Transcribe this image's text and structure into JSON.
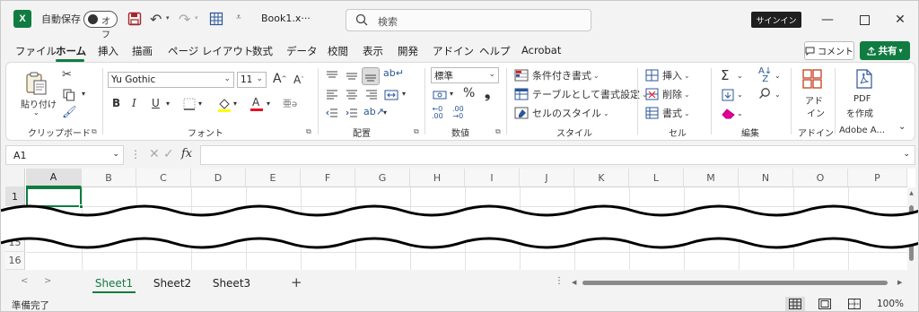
{
  "titlebar": {
    "app_icon_letter": "X",
    "autosave_label": "自動保存",
    "autosave_state": "オフ",
    "filename": "Book1.x···",
    "qat_more": "⩡",
    "search_placeholder": "検索",
    "signin_label": "サインイン"
  },
  "tabs": [
    {
      "label": "ファイル",
      "active": false
    },
    {
      "label": "ホーム",
      "active": true
    },
    {
      "label": "挿入",
      "active": false
    },
    {
      "label": "描画",
      "active": false
    },
    {
      "label": "ページ レイアウト",
      "active": false
    },
    {
      "label": "数式",
      "active": false
    },
    {
      "label": "データ",
      "active": false
    },
    {
      "label": "校閲",
      "active": false
    },
    {
      "label": "表示",
      "active": false
    },
    {
      "label": "開発",
      "active": false
    },
    {
      "label": "アドイン",
      "active": false
    },
    {
      "label": "ヘルプ",
      "active": false
    },
    {
      "label": "Acrobat",
      "active": false
    }
  ],
  "comment_label": "コメント",
  "share_label": "共有",
  "ribbon": {
    "clipboard": {
      "paste": "貼り付け",
      "label": "クリップボード"
    },
    "font": {
      "name": "Yu Gothic",
      "size": "11",
      "bold": "B",
      "italic": "I",
      "underline": "U",
      "grow": "A",
      "shrink": "A",
      "label": "フォント"
    },
    "alignment": {
      "label": "配置"
    },
    "number": {
      "format": "標準",
      "percent": "%",
      "comma": "❟",
      "label": "数値"
    },
    "styles": {
      "conditional": "条件付き書式",
      "table": "テーブルとして書式設定",
      "cell_styles": "セルのスタイル",
      "label": "スタイル"
    },
    "cells": {
      "insert": "挿入",
      "delete": "削除",
      "format": "書式",
      "label": "セル"
    },
    "editing": {
      "label": "編集"
    },
    "addins": {
      "label_line1": "アド",
      "label_line2": "イン",
      "label": "アドイン"
    },
    "adobe": {
      "line1": "PDF",
      "line2": "を作成",
      "label": "Adobe A..."
    }
  },
  "formula_bar": {
    "cell_ref": "A1",
    "fx": "fx",
    "content": ""
  },
  "grid": {
    "columns": [
      "A",
      "B",
      "C",
      "D",
      "E",
      "F",
      "G",
      "H",
      "I",
      "J",
      "K",
      "L",
      "M",
      "N",
      "O",
      "P"
    ],
    "rows_top": [
      "1"
    ],
    "rows_bottom": [
      "15",
      "16"
    ],
    "selected_cell": "A1"
  },
  "sheets": [
    {
      "name": "Sheet1",
      "active": true
    },
    {
      "name": "Sheet2",
      "active": false
    },
    {
      "name": "Sheet3",
      "active": false
    }
  ],
  "add_sheet": "+",
  "status": {
    "text": "準備完了",
    "zoom": "100%"
  },
  "colors": {
    "accent": "#107c41"
  }
}
